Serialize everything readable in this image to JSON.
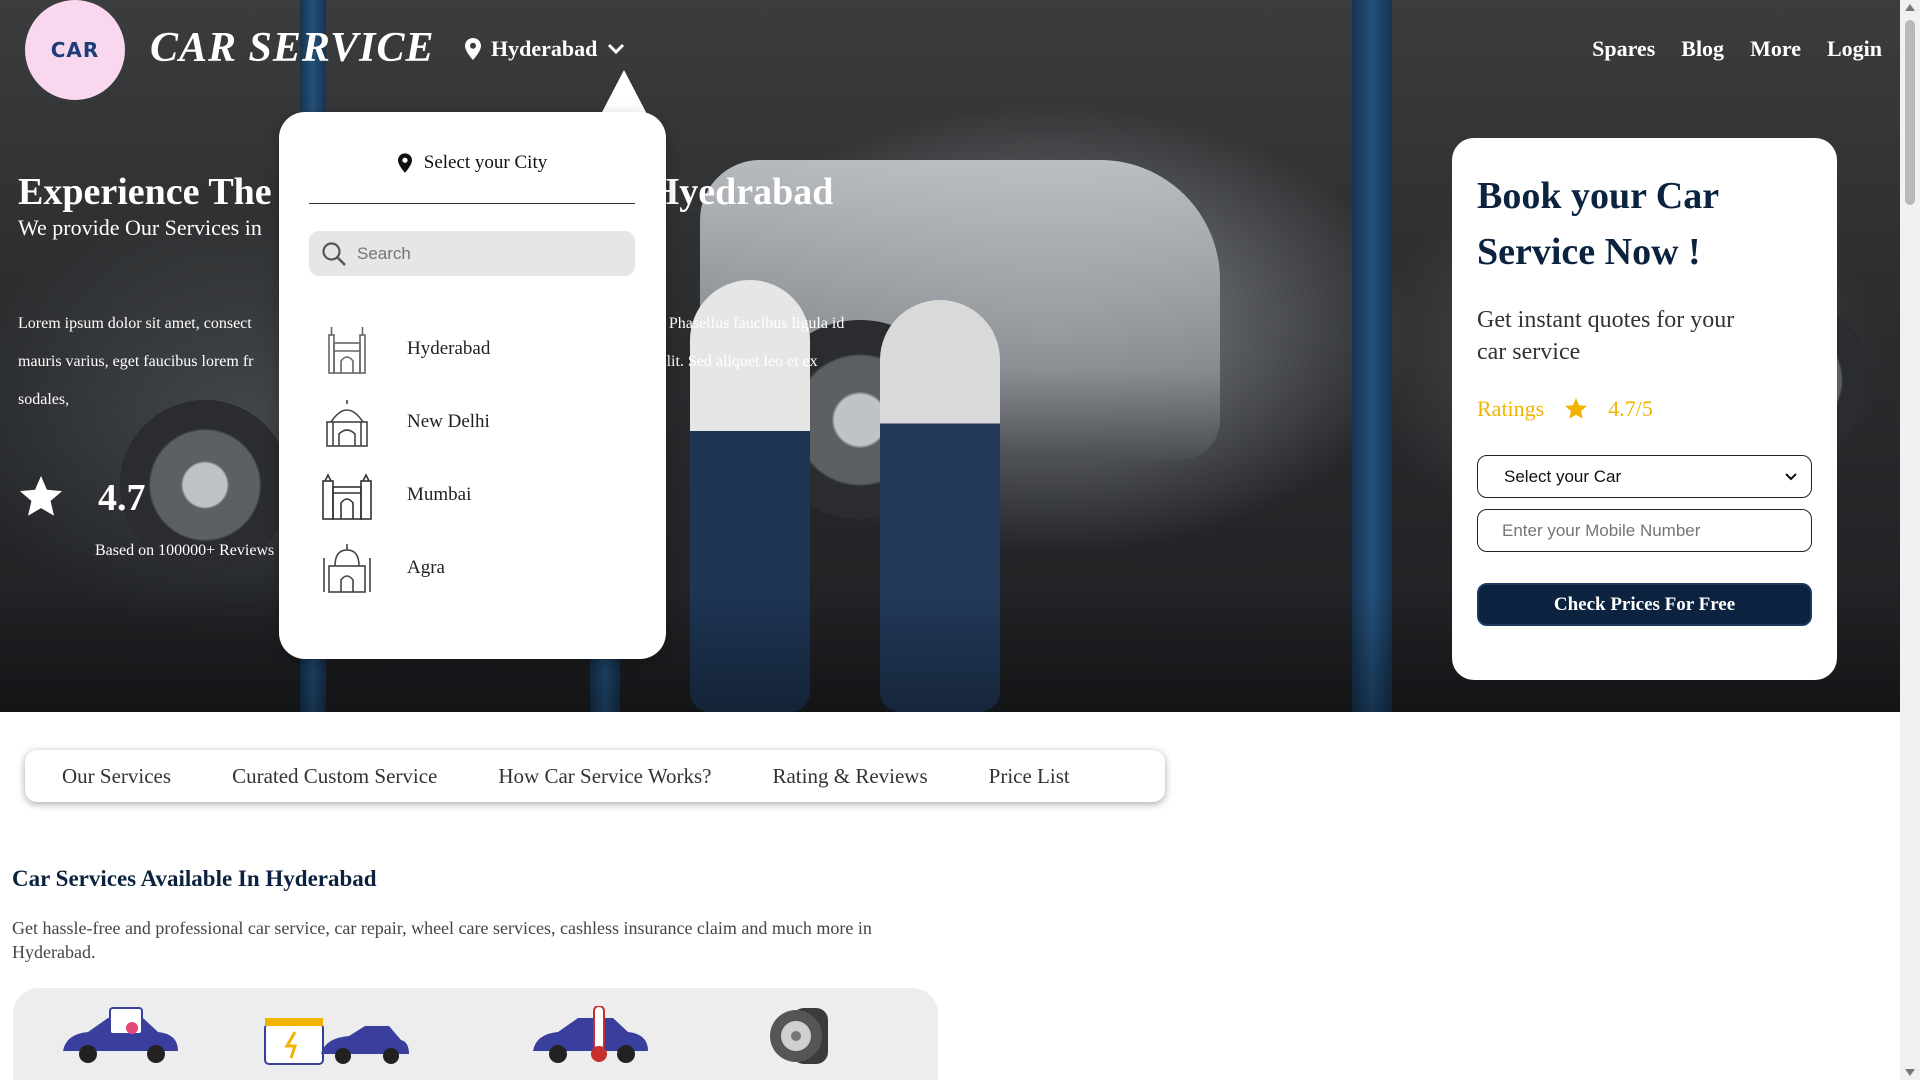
{
  "header": {
    "brand": "CAR SERVICE",
    "logo_text": "CAR",
    "city": "Hyderabad",
    "nav": [
      "Spares",
      "Blog",
      "More",
      "Login"
    ]
  },
  "hero": {
    "title": "Experience The Best Car Services In Hyedrabad",
    "title_left": "Experience The",
    "title_right": "Hyedrabad",
    "subtitle": "We provide Our Services in",
    "lorem_line1_left": "Lorem ipsum dolor sit amet, consect",
    "lorem_line1_right": "cilisi. Phasellus faucibus ligula id",
    "lorem_line2_left": "mauris varius, eget faucibus lorem fr",
    "lorem_line2_right": "iat velit. Sed aliquet leo et ex",
    "lorem_line3": "sodales,",
    "rating": "4.7",
    "rating_caption": "Based on 100000+ Reviews"
  },
  "city_dropdown": {
    "heading": "Select your City",
    "search_placeholder": "Search",
    "cities": [
      {
        "name": "Hyderabad",
        "icon": "charminar-icon"
      },
      {
        "name": "New Delhi",
        "icon": "lotus-temple-icon"
      },
      {
        "name": "Mumbai",
        "icon": "gateway-of-india-icon"
      },
      {
        "name": "Agra",
        "icon": "taj-mahal-icon"
      }
    ]
  },
  "booking": {
    "title": "Book your Car Service Now !",
    "subtitle": "Get instant quotes for your car service",
    "ratings_label": "Ratings",
    "ratings_value": "4.7/5",
    "select_car": "Select your Car",
    "mobile_placeholder": "Enter your Mobile Number",
    "cta": "Check Prices For Free"
  },
  "tabs": [
    "Our Services",
    "Curated Custom Service",
    "How Car Service Works?",
    "Rating & Reviews",
    "Price List"
  ],
  "services": {
    "title": "Car Services Available In Hyderabad",
    "description": "Get hassle-free and professional car service, car repair, wheel care services, cashless insurance claim and much more in Hyderabad."
  },
  "colors": {
    "navy": "#0c2340",
    "gold": "#f0b400",
    "logo_bg": "#f8d7ef"
  }
}
